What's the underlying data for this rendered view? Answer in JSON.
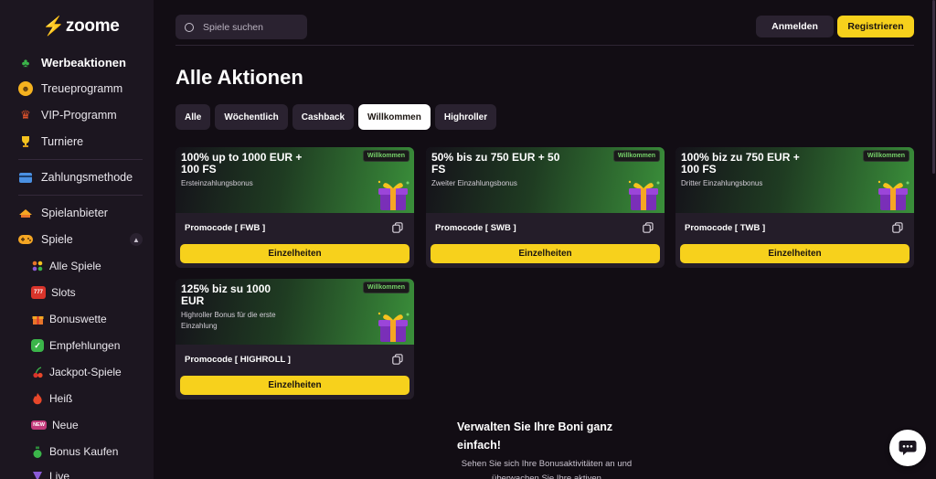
{
  "brand": {
    "name": "zoome",
    "accent": "#f7d11c"
  },
  "sidebar": {
    "items": [
      {
        "label": "Werbeaktionen",
        "icon": "clover-icon",
        "color": "#3bb54a"
      },
      {
        "label": "Treueprogramm",
        "icon": "smiley-icon",
        "color": "#f5b21f"
      },
      {
        "label": "VIP-Programm",
        "icon": "crown-icon",
        "color": "#d9342b"
      },
      {
        "label": "Turniere",
        "icon": "trophy-icon",
        "color": "#f5c21f"
      },
      {
        "label": "Zahlungsmethode",
        "icon": "card-icon",
        "color": "#4a90e2"
      },
      {
        "label": "Spielanbieter",
        "icon": "provider-icon",
        "color": "#f5a623"
      },
      {
        "label": "Spiele",
        "icon": "gamepad-icon",
        "color": "#f5a623"
      }
    ],
    "subitems": [
      {
        "label": "Alle Spiele",
        "icon": "grid-icon",
        "glyph": "",
        "color": "#e8742a"
      },
      {
        "label": "Slots",
        "icon": "slots-icon",
        "glyph": "777",
        "color": "#d9342b"
      },
      {
        "label": "Bonuswette",
        "icon": "gift-icon",
        "glyph": "",
        "color": "#e8742a"
      },
      {
        "label": "Empfehlungen",
        "icon": "check-icon",
        "glyph": "✓",
        "color": "#3bb54a"
      },
      {
        "label": "Jackpot-Spiele",
        "icon": "cherry-icon",
        "glyph": "",
        "color": "#d9342b"
      },
      {
        "label": "Heiß",
        "icon": "fire-icon",
        "glyph": "",
        "color": "#e8472a"
      },
      {
        "label": "Neue",
        "icon": "new-icon",
        "glyph": "NEW",
        "color": "#c23a7a"
      },
      {
        "label": "Bonus Kaufen",
        "icon": "moneybag-icon",
        "glyph": "",
        "color": "#3bb54a"
      },
      {
        "label": "Live",
        "icon": "live-icon",
        "glyph": "",
        "color": "#8a5bd6"
      }
    ]
  },
  "header": {
    "search_placeholder": "Spiele suchen",
    "login_label": "Anmelden",
    "register_label": "Registrieren"
  },
  "main": {
    "title": "Alle Aktionen",
    "tabs": [
      {
        "label": "Alle",
        "active": false
      },
      {
        "label": "Wöchentlich",
        "active": false
      },
      {
        "label": "Cashback",
        "active": false
      },
      {
        "label": "Willkommen",
        "active": true
      },
      {
        "label": "Highroller",
        "active": false
      }
    ],
    "cards": [
      {
        "title": "100% up to 1000 EUR + 100 FS",
        "subtitle": "Ersteinzahlungsbonus",
        "badge": "Willkommen",
        "promo": "Promocode [ FWB ]",
        "button": "Einzelheiten"
      },
      {
        "title": "50% bis zu 750 EUR + 50 FS",
        "subtitle": "Zweiter Einzahlungsbonus",
        "badge": "Willkommen",
        "promo": "Promocode [ SWB ]",
        "button": "Einzelheiten"
      },
      {
        "title": "100% biz zu 750 EUR + 100 FS",
        "subtitle": "Dritter Einzahlungsbonus",
        "badge": "Willkommen",
        "promo": "Promocode [ TWB ]",
        "button": "Einzelheiten"
      },
      {
        "title": "125% biz su 1000 EUR",
        "subtitle": "Highroller Bonus für die erste Einzahlung",
        "badge": "Willkommen",
        "promo": "Promocode [ HIGHROLL ]",
        "button": "Einzelheiten"
      }
    ],
    "manage": {
      "title": "Verwalten Sie Ihre Boni ganz einfach!",
      "text": "Sehen Sie sich Ihre Bonusaktivitäten an und überwachen Sie Ihre aktiven"
    }
  }
}
